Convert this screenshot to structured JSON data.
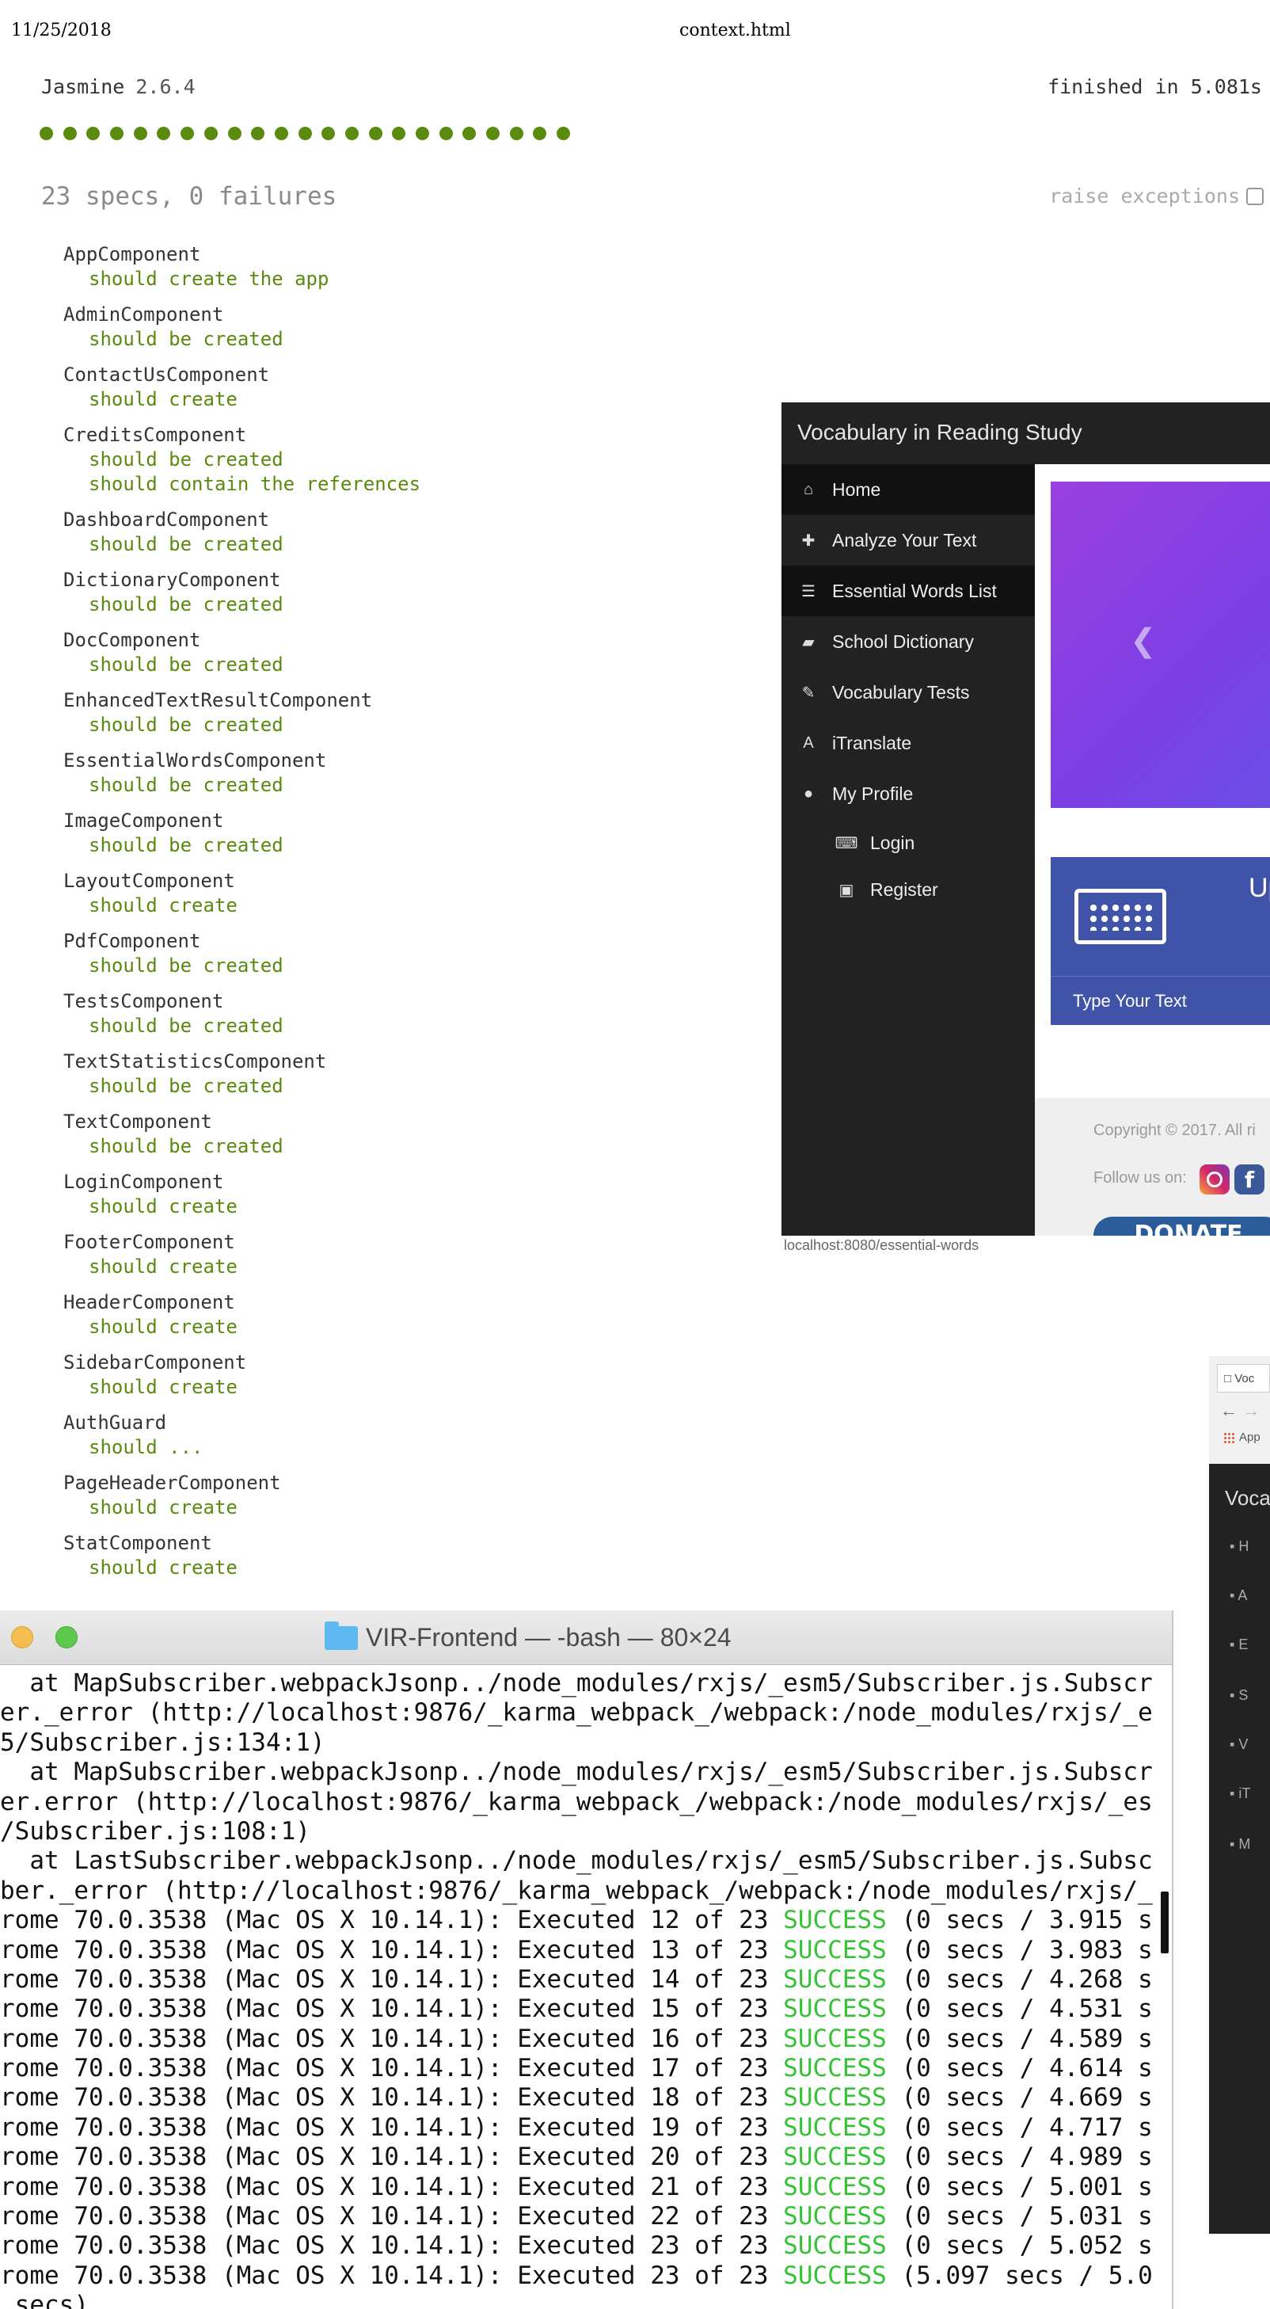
{
  "print": {
    "date": "11/25/2018",
    "title": "context.html"
  },
  "jasmine": {
    "name": "Jasmine",
    "version": "2.6.4",
    "duration": "finished in 5.081s",
    "summary": "23 specs, 0 failures",
    "raise_label": "raise exceptions",
    "dot_count": 23,
    "suites": [
      {
        "name": "AppComponent",
        "specs": [
          "should create the app"
        ]
      },
      {
        "name": "AdminComponent",
        "specs": [
          "should be created"
        ]
      },
      {
        "name": "ContactUsComponent",
        "specs": [
          "should create"
        ]
      },
      {
        "name": "CreditsComponent",
        "specs": [
          "should be created",
          "should contain the references"
        ]
      },
      {
        "name": "DashboardComponent",
        "specs": [
          "should be created"
        ]
      },
      {
        "name": "DictionaryComponent",
        "specs": [
          "should be created"
        ]
      },
      {
        "name": "DocComponent",
        "specs": [
          "should be created"
        ]
      },
      {
        "name": "EnhancedTextResultComponent",
        "specs": [
          "should be created"
        ]
      },
      {
        "name": "EssentialWordsComponent",
        "specs": [
          "should be created"
        ]
      },
      {
        "name": "ImageComponent",
        "specs": [
          "should be created"
        ]
      },
      {
        "name": "LayoutComponent",
        "specs": [
          "should create"
        ]
      },
      {
        "name": "PdfComponent",
        "specs": [
          "should be created"
        ]
      },
      {
        "name": "TestsComponent",
        "specs": [
          "should be created"
        ]
      },
      {
        "name": "TextStatisticsComponent",
        "specs": [
          "should be created"
        ]
      },
      {
        "name": "TextComponent",
        "specs": [
          "should be created"
        ]
      },
      {
        "name": "LoginComponent",
        "specs": [
          "should create"
        ]
      },
      {
        "name": "FooterComponent",
        "specs": [
          "should create"
        ]
      },
      {
        "name": "HeaderComponent",
        "specs": [
          "should create"
        ]
      },
      {
        "name": "SidebarComponent",
        "specs": [
          "should create"
        ]
      },
      {
        "name": "AuthGuard",
        "specs": [
          "should ..."
        ]
      },
      {
        "name": "PageHeaderComponent",
        "specs": [
          "should create"
        ]
      },
      {
        "name": "StatComponent",
        "specs": [
          "should create"
        ]
      }
    ]
  },
  "app": {
    "title": "Vocabulary in Reading Study",
    "nav": [
      {
        "label": "Home",
        "icon": "home-icon",
        "glyph": "⌂"
      },
      {
        "label": "Analyze Your Text",
        "icon": "plus-icon",
        "glyph": "✚"
      },
      {
        "label": "Essential Words List",
        "icon": "list-icon",
        "glyph": "☰"
      },
      {
        "label": "School Dictionary",
        "icon": "book-icon",
        "glyph": "▰"
      },
      {
        "label": "Vocabulary Tests",
        "icon": "edit-icon",
        "glyph": "✎"
      },
      {
        "label": "iTranslate",
        "icon": "font-icon",
        "glyph": "A"
      },
      {
        "label": "My Profile",
        "icon": "user-icon",
        "glyph": "●"
      },
      {
        "label": "Login",
        "icon": "keyboard-icon",
        "glyph": "⌨"
      },
      {
        "label": "Register",
        "icon": "id-badge-icon",
        "glyph": "▣"
      }
    ],
    "card_title": "Up",
    "card_footer": "Type Your Text",
    "copyright": "Copyright © 2017. All ri",
    "follow": "Follow us on:",
    "donate": "DONATE",
    "status_url": "localhost:8080/essential-words"
  },
  "mini": {
    "tab": "Voc",
    "apps": "App",
    "title": "Voca",
    "items": [
      "H",
      "A",
      "E",
      "S",
      "V",
      "iT",
      "M"
    ]
  },
  "terminal": {
    "title": "VIR-Frontend — -bash — 80×24",
    "plain_lines": [
      "  at MapSubscriber.webpackJsonp../node_modules/rxjs/_esm5/Subscriber.js.Subscr",
      "er._error (http://localhost:9876/_karma_webpack_/webpack:/node_modules/rxjs/_e",
      "5/Subscriber.js:134:1)",
      "  at MapSubscriber.webpackJsonp../node_modules/rxjs/_esm5/Subscriber.js.Subscr",
      "er.error (http://localhost:9876/_karma_webpack_/webpack:/node_modules/rxjs/_es",
      "/Subscriber.js:108:1)",
      "  at LastSubscriber.webpackJsonp../node_modules/rxjs/_esm5/Subscriber.js.Subsc",
      "ber._error (http://localhost:9876/_karma_webpack_/webpack:/node_modules/rxjs/_"
    ],
    "run_prefix": "rome 70.0.3538 (Mac OS X 10.14.1): Executed ",
    "run_of": " of 23 ",
    "success": "SUCCESS",
    "runs": [
      {
        "n": "12",
        "tail": " (0 secs / 3.915 s"
      },
      {
        "n": "13",
        "tail": " (0 secs / 3.983 s"
      },
      {
        "n": "14",
        "tail": " (0 secs / 4.268 s"
      },
      {
        "n": "15",
        "tail": " (0 secs / 4.531 s"
      },
      {
        "n": "16",
        "tail": " (0 secs / 4.589 s"
      },
      {
        "n": "17",
        "tail": " (0 secs / 4.614 s"
      },
      {
        "n": "18",
        "tail": " (0 secs / 4.669 s"
      },
      {
        "n": "19",
        "tail": " (0 secs / 4.717 s"
      },
      {
        "n": "20",
        "tail": " (0 secs / 4.989 s"
      },
      {
        "n": "21",
        "tail": " (0 secs / 5.001 s"
      },
      {
        "n": "22",
        "tail": " (0 secs / 5.031 s"
      },
      {
        "n": "23",
        "tail": " (0 secs / 5.052 s"
      },
      {
        "n": "23",
        "tail": " (5.097 secs / 5.0"
      }
    ],
    "last_line": "secs)"
  }
}
